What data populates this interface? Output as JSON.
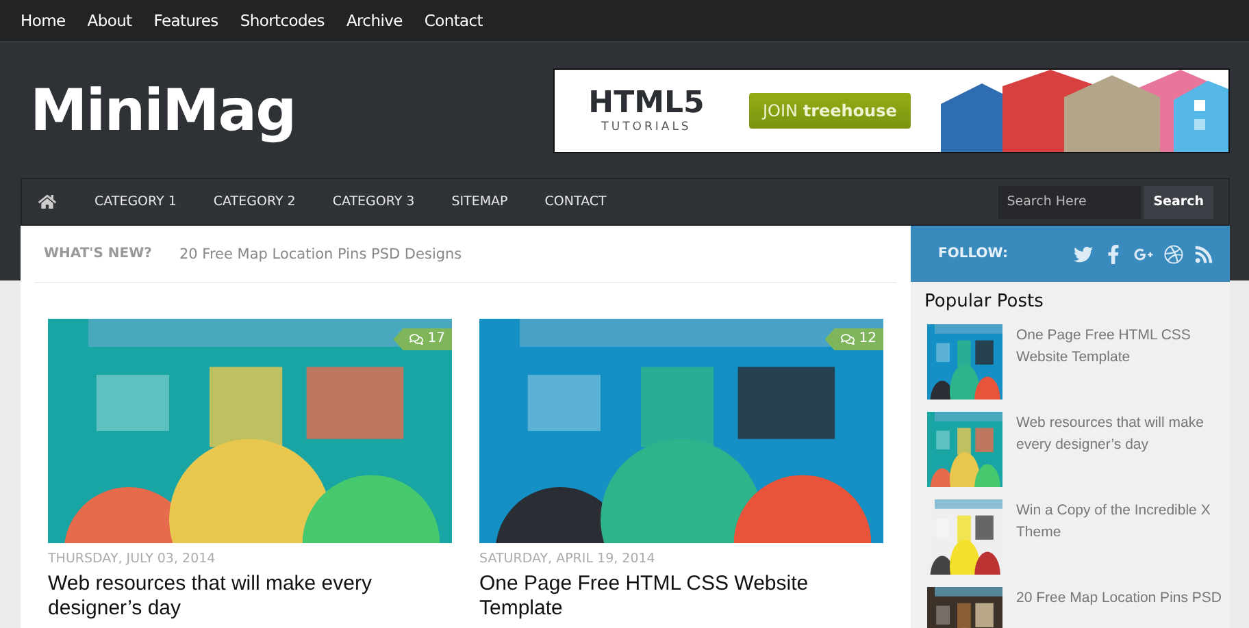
{
  "top_menu": [
    "Home",
    "About",
    "Features",
    "Shortcodes",
    "Archive",
    "Contact"
  ],
  "logo": "MiniMag",
  "banner": {
    "title": "HTML5",
    "subtitle": "TUTORIALS",
    "button": "JOIN **treehouse**"
  },
  "nav": {
    "items": [
      "CATEGORY 1",
      "CATEGORY 2",
      "CATEGORY 3",
      "SITEMAP",
      "CONTACT"
    ],
    "search": {
      "placeholder": "Search Here",
      "button": "Search"
    }
  },
  "ticker": {
    "label": "WHAT'S NEW?",
    "text": "20 Free Map Location Pins PSD Designs"
  },
  "posts": [
    {
      "comments": "17",
      "date": "THURSDAY, JULY 03, 2014",
      "title": "Web resources that will make every designer’s day"
    },
    {
      "comments": "12",
      "date": "SATURDAY, APRIL 19, 2014",
      "title": "One Page Free HTML CSS Website Template"
    }
  ],
  "follow": {
    "label": "FOLLOW:"
  },
  "popular": {
    "title": "Popular Posts",
    "items": [
      "One Page Free HTML CSS Website Template",
      "Web resources that will make every designer’s day",
      "Win a Copy of the Incredible X Theme",
      "20 Free Map Location Pins PSD"
    ]
  }
}
